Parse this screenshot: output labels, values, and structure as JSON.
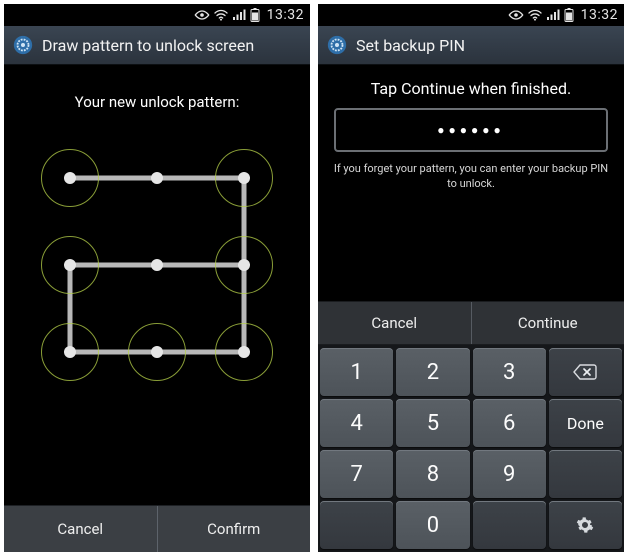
{
  "status": {
    "time": "13:32"
  },
  "left": {
    "header_title": "Draw pattern to unlock screen",
    "caption": "Your new unlock pattern:",
    "cancel": "Cancel",
    "confirm": "Confirm",
    "pattern_sequence": [
      1,
      3,
      9,
      8,
      7,
      4,
      6
    ],
    "selected_dots": [
      1,
      3,
      4,
      6,
      7,
      8,
      9
    ]
  },
  "right": {
    "header_title": "Set backup PIN",
    "caption": "Tap Continue when finished.",
    "pin_mask": "●●●●●●",
    "help": "If you forget your pattern, you can enter your backup PIN to unlock.",
    "cancel": "Cancel",
    "continue": "Continue",
    "keys": {
      "k1": "1",
      "k2": "2",
      "k3": "3",
      "k4": "4",
      "k5": "5",
      "k6": "6",
      "k7": "7",
      "k8": "8",
      "k9": "9",
      "k0": "0",
      "done": "Done",
      "backspace": "⌫",
      "gear": "✻"
    }
  }
}
